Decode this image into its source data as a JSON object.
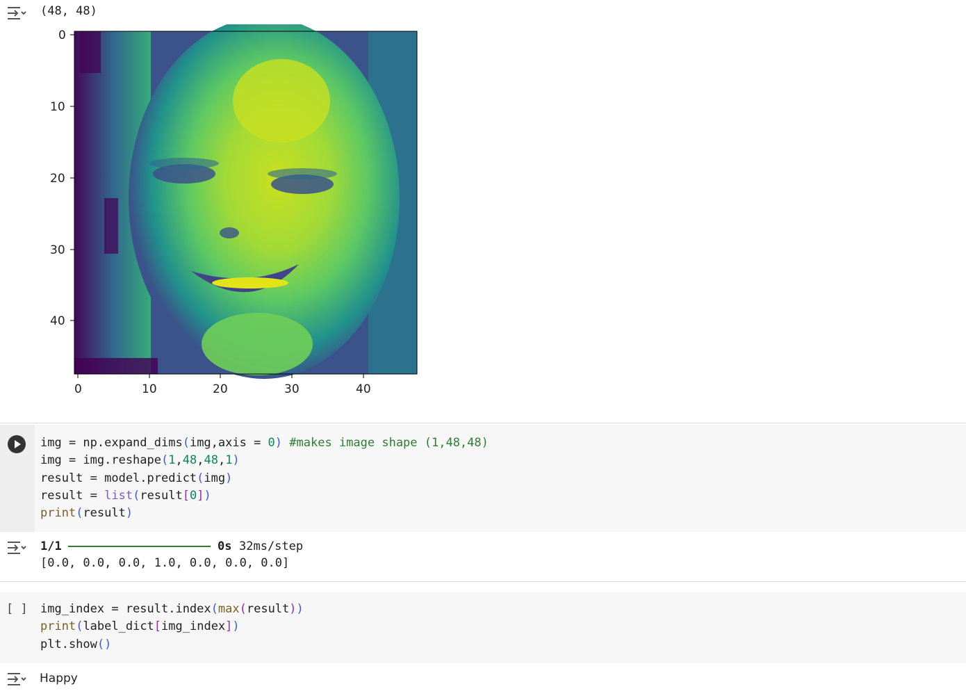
{
  "output1": {
    "shape_text": "(48, 48)"
  },
  "plot": {
    "y_ticks": [
      "0",
      "10",
      "20",
      "30",
      "40"
    ],
    "x_ticks": [
      "0",
      "10",
      "20",
      "30",
      "40"
    ],
    "colormap": "viridis"
  },
  "cell1": {
    "lines": [
      [
        "img = np.expand_dims(img,axis = 0) ",
        "#makes image shape (1,48,48)"
      ],
      [
        "img = img.reshape(1,48,48,1)"
      ],
      [
        "result = model.predict(img)"
      ],
      [
        "result = list(result[0])"
      ],
      [
        "print(result)"
      ]
    ]
  },
  "output2": {
    "progress_count": "1/1",
    "progress_fraction": 1.0,
    "progress_time": "0s",
    "progress_rate": "32ms/step",
    "result_text": "[0.0, 0.0, 0.0, 1.0, 0.0, 0.0, 0.0]"
  },
  "cell2": {
    "brackets": "[ ]",
    "lines": [
      "img_index = result.index(max(result))",
      "print(label_dict[img_index])",
      "plt.show()"
    ]
  },
  "output3": {
    "text": "Happy"
  },
  "colors": {
    "progress": "#2e7d32",
    "code_bg": "#f7f7f7"
  }
}
